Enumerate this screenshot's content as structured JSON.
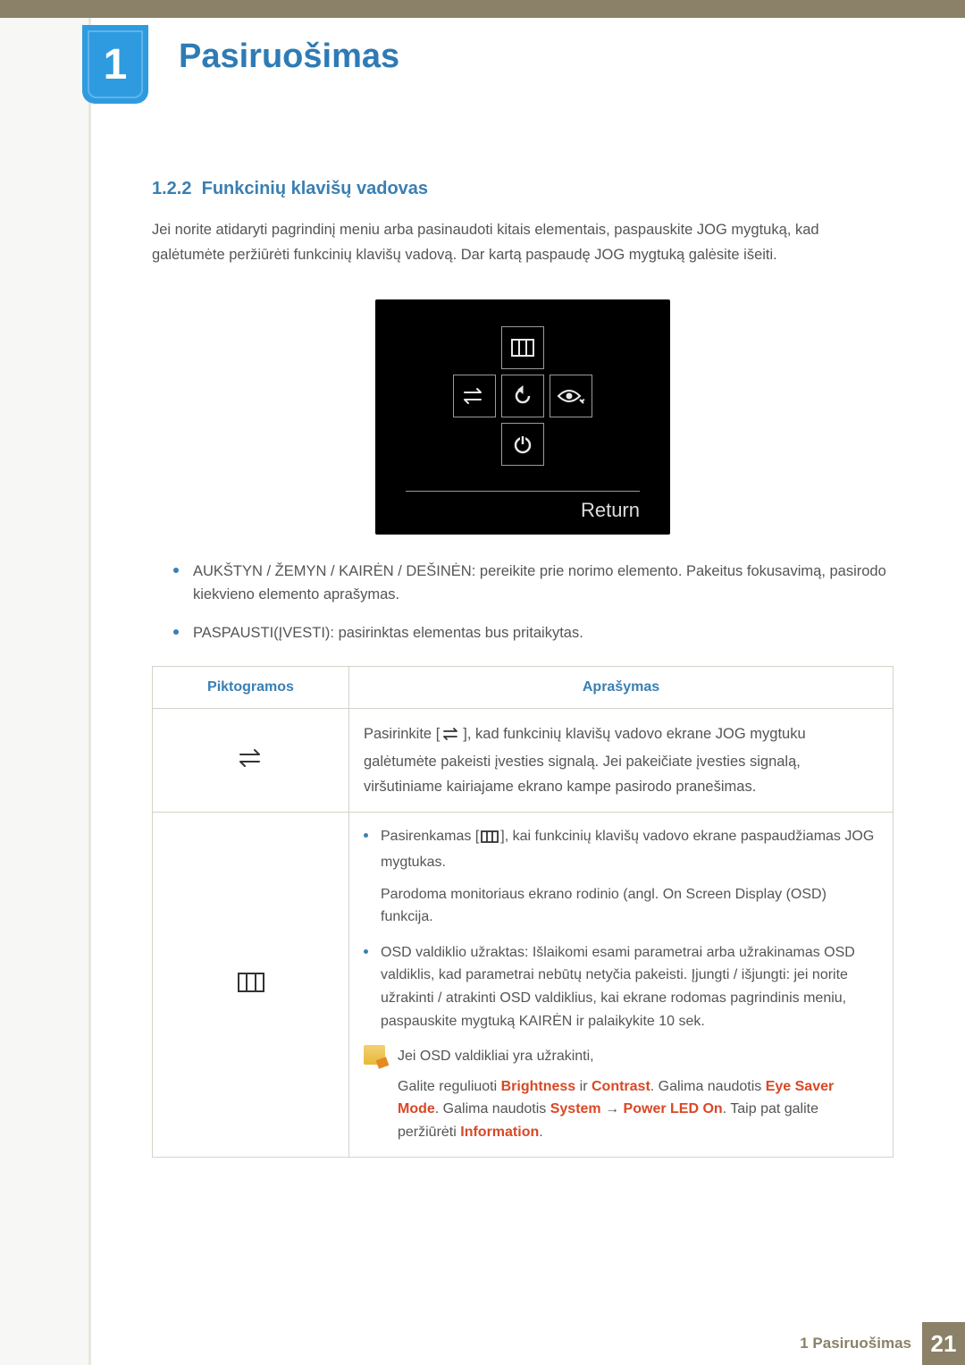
{
  "chapter": {
    "num": "1",
    "title": "Pasiruošimas"
  },
  "section": {
    "num": "1.2.2",
    "title": "Funkcinių klavišų vadovas"
  },
  "intro": "Jei norite atidaryti pagrindinį meniu arba pasinaudoti kitais elementais, paspauskite JOG mygtuką, kad galėtumėte peržiūrėti funkcinių klavišų vadovą. Dar kartą paspaudę JOG mygtuką galėsite išeiti.",
  "osd": {
    "return_label": "Return"
  },
  "bullets": [
    "AUKŠTYN / ŽEMYN / KAIRĖN / DEŠINĖN: pereikite prie norimo elemento. Pakeitus fokusavimą, pasirodo kiekvieno elemento aprašymas.",
    "PASPAUSTI(ĮVESTI): pasirinktas elementas bus pritaikytas."
  ],
  "table": {
    "headers": {
      "icons": "Piktogramos",
      "desc": "Aprašymas"
    },
    "rows": [
      {
        "icon": "source",
        "desc_parts": {
          "pre": "Pasirinkite [",
          "post": "], kad funkcinių klavišų vadovo ekrane JOG mygtuku galėtumėte pakeisti įvesties signalą. Jei pakeičiate įvesties signalą, viršutiniame kairiajame ekrano kampe pasirodo pranešimas."
        }
      },
      {
        "icon": "menu",
        "items": [
          {
            "pre": "Pasirenkamas [",
            "post": "], kai funkcinių klavišų vadovo ekrane paspaudžiamas JOG mygtukas.",
            "extra": "Parodoma monitoriaus ekrano rodinio (angl. On Screen Display (OSD) funkcija."
          },
          {
            "text": "OSD valdiklio užraktas: Išlaikomi esami parametrai arba užrakinamas OSD valdiklis, kad parametrai nebūtų netyčia pakeisti. Įjungti / išjungti: jei norite užrakinti / atrakinti OSD valdiklius, kai ekrane rodomas pagrindinis meniu, paspauskite mygtuką KAIRĖN ir palaikykite 10 sek."
          }
        ],
        "note": {
          "lead": "Jei OSD valdikliai yra užrakinti,",
          "p1": "Galite reguliuoti ",
          "b1": "Brightness",
          "m1": " ir ",
          "b2": "Contrast",
          "m2": ". Galima naudotis ",
          "b3": "Eye Saver Mode",
          "m3": ". Galima naudotis ",
          "b4": "System",
          "arrow": " → ",
          "b5": "Power LED On",
          "m4": ". Taip pat galite peržiūrėti ",
          "b6": "Information",
          "end": "."
        }
      }
    ]
  },
  "footer": {
    "label": "1 Pasiruošimas",
    "page": "21"
  }
}
